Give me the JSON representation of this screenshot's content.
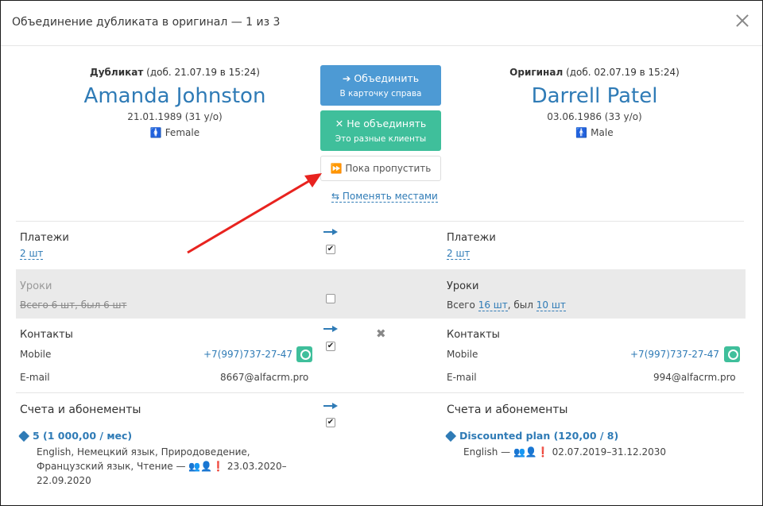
{
  "header": {
    "title": "Объединение дубликата в оригинал  —  1 из 3"
  },
  "duplicate": {
    "head_label": "Дубликат",
    "head_added": "(доб. 21.07.19 в 15:24)",
    "name": "Amanda Johnston",
    "birth": "21.01.1989 (31 у/о)",
    "gender": "Female"
  },
  "original": {
    "head_label": "Оригинал",
    "head_added": "(доб. 02.07.19 в 15:24)",
    "name": "Darrell Patel",
    "birth": "03.06.1986 (33 у/о)",
    "gender": "Male"
  },
  "actions": {
    "merge_l1": "➔ Объединить",
    "merge_l2": "В карточку справа",
    "no_merge_l1": "✕ Не объединять",
    "no_merge_l2": "Это разные клиенты",
    "skip": "⏩ Пока пропустить",
    "swap": "⇆ Поменять местами"
  },
  "sections": {
    "payments": {
      "title": "Платежи",
      "left": "2 шт",
      "right": "2 шт",
      "checked": true
    },
    "lessons": {
      "title": "Уроки",
      "left": "Всего 6 шт, был 6 шт",
      "right_prefix": "Всего",
      "right_total": "16 шт",
      "right_mid": ", был",
      "right_attended": "10 шт",
      "checked": false
    },
    "contacts": {
      "title": "Контакты",
      "mobile_label": "Mobile",
      "email_label": "E-mail",
      "left_mobile": "+7(997)737-27-47",
      "left_email": "8667@alfacrm.pro",
      "right_mobile": "+7(997)737-27-47",
      "right_email": "994@alfacrm.pro",
      "checked": true
    },
    "accounts": {
      "title": "Счета и абонементы",
      "left_plan": "5 (1 000,00 / мес)",
      "left_detail_1": "English, Немецкий язык, Природоведение,",
      "left_detail_2": "Французский язык, Чтение — 👥👤❗ 23.03.2020–",
      "left_detail_3": "22.09.2020",
      "right_plan": "Discounted plan (120,00 / 8)",
      "right_detail": "English — 👥👤❗ 02.07.2019–31.12.2030",
      "checked": true
    }
  },
  "colors": {
    "accent": "#2f7bb6",
    "merge": "#4d9ad4",
    "no_merge": "#3fbf9b",
    "annotation_arrow": "#e8231f"
  }
}
